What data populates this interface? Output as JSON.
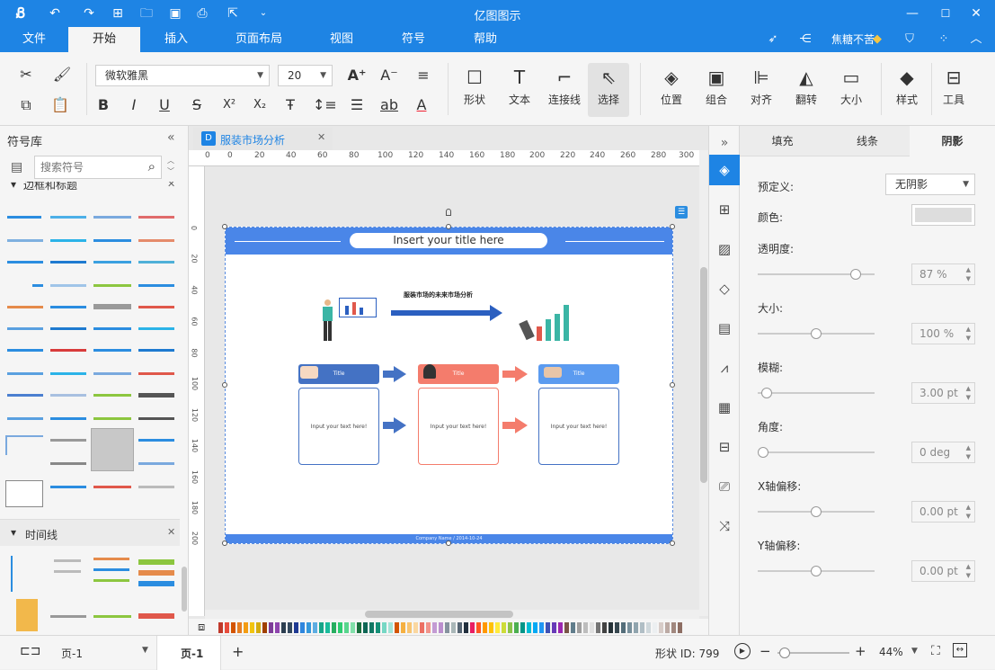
{
  "app": {
    "title": "亿图图示"
  },
  "menu": {
    "items": [
      "文件",
      "开始",
      "插入",
      "页面布局",
      "视图",
      "符号",
      "帮助"
    ],
    "active": "开始",
    "user": "焦糖不苦"
  },
  "ribbon": {
    "font": "微软雅黑",
    "font_size": "20",
    "tools": [
      {
        "label": "形状",
        "glyph": "☐"
      },
      {
        "label": "文本",
        "glyph": "T"
      },
      {
        "label": "连接线",
        "glyph": "⌐"
      },
      {
        "label": "选择",
        "glyph": "⇖"
      },
      {
        "label": "位置",
        "glyph": "◈"
      },
      {
        "label": "组合",
        "glyph": "▣"
      },
      {
        "label": "对齐",
        "glyph": "⊫"
      },
      {
        "label": "翻转",
        "glyph": "◭"
      },
      {
        "label": "大小",
        "glyph": "▭"
      },
      {
        "label": "样式",
        "glyph": "◆"
      },
      {
        "label": "工具",
        "glyph": "⊟"
      }
    ]
  },
  "library": {
    "title": "符号库",
    "search_placeholder": "搜索符号",
    "section_1": "边框和标题",
    "section_2": "时间线"
  },
  "document": {
    "tab_title": "服装市场分析",
    "ruler_marks": [
      "0",
      "20",
      "40",
      "60",
      "80",
      "100",
      "120",
      "140",
      "160",
      "180",
      "200",
      "220",
      "240",
      "260",
      "280",
      "300"
    ],
    "vruler_marks": [
      "0",
      "20",
      "40",
      "60",
      "80",
      "100",
      "120",
      "140",
      "160",
      "180",
      "200"
    ],
    "slide_title": "Insert your title here",
    "heading": "服装市场的未来市场分析",
    "card_title": "Title",
    "card_text": "Input your text here!",
    "footer": "Company Name / 2014-10-24"
  },
  "properties": {
    "tabs": [
      "填充",
      "线条",
      "阴影"
    ],
    "active_tab": "阴影",
    "preset_label": "预定义:",
    "preset_value": "无阴影",
    "color_label": "颜色:",
    "opacity_label": "透明度:",
    "opacity_value": "87 %",
    "opacity_level": 0.87,
    "size_label": "大小:",
    "size_value": "100 %",
    "blur_label": "模糊:",
    "blur_value": "3.00 pt",
    "angle_label": "角度:",
    "angle_value": "0 deg",
    "xoff_label": "X轴偏移:",
    "xoff_value": "0.00 pt",
    "yoff_label": "Y轴偏移:",
    "yoff_value": "0.00 pt"
  },
  "status": {
    "page_select": "页-1",
    "page_tab": "页-1",
    "add_page": "+",
    "shape_id": "形状 ID:  799",
    "zoom": "44%"
  },
  "colors": {
    "accent": "#1e84e4",
    "card_blue": "#4472c4",
    "card_coral": "#f47c6c",
    "card_sky": "#5b9bf0"
  }
}
